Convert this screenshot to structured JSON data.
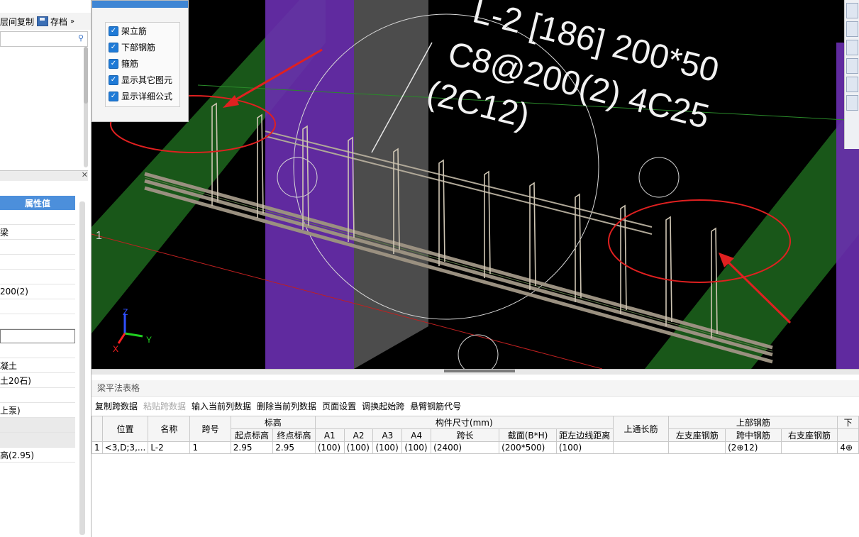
{
  "toolbar": {
    "copy_floor_label": "层间复制",
    "save_label": "存档",
    "more_icon": "»"
  },
  "search": {
    "icon": "search-icon"
  },
  "properties": {
    "header": "属性值",
    "rows": [
      "",
      "梁",
      "",
      "",
      "",
      "200(2)",
      "",
      "",
      "",
      "",
      "凝土",
      "土20石)",
      "",
      "上泵)",
      "",
      "",
      "高(2.95)"
    ]
  },
  "display_options": {
    "items": [
      {
        "label": "架立筋",
        "checked": true
      },
      {
        "label": "下部钢筋",
        "checked": true
      },
      {
        "label": "箍筋",
        "checked": true
      },
      {
        "label": "显示其它图元",
        "checked": true
      },
      {
        "label": "显示详细公式",
        "checked": true
      }
    ]
  },
  "viewport": {
    "annotation_line1": "L-2 [186] 200*50",
    "annotation_line2": "C8@200(2) 4C25",
    "annotation_line3": "(2C12)",
    "grid_label": "1",
    "axis_x": "X",
    "axis_y": "Y",
    "axis_z": "Z"
  },
  "bottom_panel": {
    "title": "梁平法表格",
    "menu": [
      {
        "label": "复制跨数据",
        "enabled": true
      },
      {
        "label": "粘贴跨数据",
        "enabled": false
      },
      {
        "label": "输入当前列数据",
        "enabled": true
      },
      {
        "label": "删除当前列数据",
        "enabled": true
      },
      {
        "label": "页面设置",
        "enabled": true
      },
      {
        "label": "调换起始跨",
        "enabled": true
      },
      {
        "label": "悬臂钢筋代号",
        "enabled": true
      }
    ],
    "table": {
      "headers_top": {
        "position": "位置",
        "name": "名称",
        "span_no": "跨号",
        "elevation": "标高",
        "dimensions": "构件尺寸(mm)",
        "top_long_bar": "上通长筋",
        "top_rebar": "上部钢筋",
        "next": "下"
      },
      "headers_sub": {
        "start_elev": "起点标高",
        "end_elev": "终点标高",
        "a1": "A1",
        "a2": "A2",
        "a3": "A3",
        "a4": "A4",
        "span_len": "跨长",
        "section": "截面(B*H)",
        "left_edge": "距左边线距离",
        "left_support": "左支座钢筋",
        "mid_span": "跨中钢筋",
        "right_support": "右支座钢筋"
      },
      "row": {
        "index": "1",
        "position": "<3,D;3,...",
        "name": "L-2",
        "span_no": "1",
        "start_elev": "2.95",
        "end_elev": "2.95",
        "a1": "(100)",
        "a2": "(100)",
        "a3": "(100)",
        "a4": "(100)",
        "span_len": "(2400)",
        "section": "(200*500)",
        "left_edge": "(100)",
        "top_long_bar": "",
        "left_support": "",
        "mid_span": "(2⊕12)",
        "right_support": "",
        "next": "4⊕"
      }
    }
  },
  "colors": {
    "viewport_bg": "#000000",
    "green_beam": "#1f6b1f",
    "purple_column": "#6a2fb0",
    "annotation_red": "#e02020",
    "accent_blue": "#4c8fdb"
  }
}
